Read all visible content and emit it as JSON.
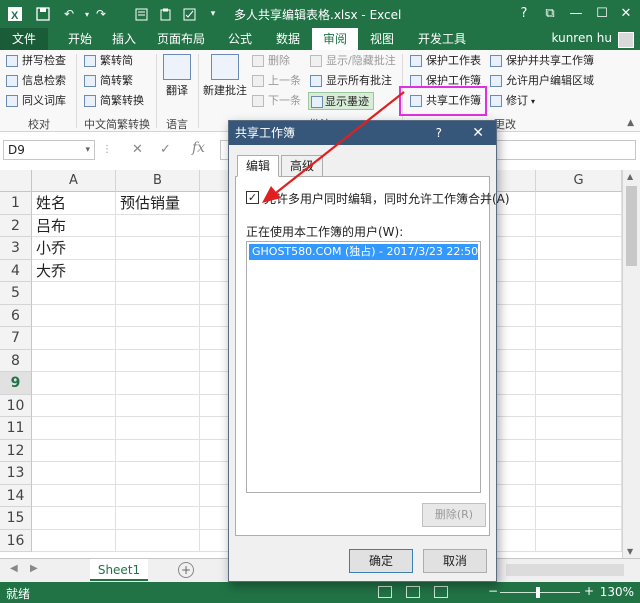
{
  "titlebar": {
    "title": "多人共享编辑表格.xlsx - Excel",
    "help": "?",
    "restore": "⧉",
    "minimize": "—",
    "maximize": "☐",
    "close": "✕"
  },
  "tabs": {
    "file": "文件",
    "items": [
      "开始",
      "插入",
      "页面布局",
      "公式",
      "数据",
      "审阅",
      "视图",
      "开发工具"
    ],
    "active": "审阅",
    "user": "kunren hu"
  },
  "ribbon": {
    "proofing": {
      "spell": "拼写检查",
      "research": "信息检索",
      "thesaurus": "同义词库",
      "label": "校对"
    },
    "chinese": {
      "t2s": "繁转简",
      "s2t": "简转繁",
      "convert": "简繁转换",
      "label": "中文简繁转换"
    },
    "language": {
      "translate": "翻译",
      "label": "语言"
    },
    "comments": {
      "new": "新建批注",
      "delete": "删除",
      "prev": "上一条",
      "next": "下一条",
      "showhide": "显示/隐藏批注",
      "showall": "显示所有批注",
      "ink": "显示墨迹",
      "label": "批注"
    },
    "changes": {
      "protect_sheet": "保护工作表",
      "protect_book": "保护工作簿",
      "share_book": "共享工作簿",
      "protect_share": "保护并共享工作簿",
      "allow_edit": "允许用户编辑区域",
      "track": "修订",
      "label": "更改"
    }
  },
  "formula_bar": {
    "namebox": "D9",
    "fx": "fx",
    "cancel": "✕",
    "enter": "✓"
  },
  "grid": {
    "columns": [
      "A",
      "B",
      "C",
      "D",
      "E",
      "F",
      "G"
    ],
    "rows": [
      "1",
      "2",
      "3",
      "4",
      "5",
      "6",
      "7",
      "8",
      "9",
      "10",
      "11",
      "12",
      "13",
      "14",
      "15",
      "16"
    ],
    "selected_row": "9",
    "cells": {
      "A1": "姓名",
      "B1": "预估销量",
      "A2": "吕布",
      "A3": "小乔",
      "A4": "大乔"
    }
  },
  "sheets": {
    "active": "Sheet1",
    "add": "+"
  },
  "statusbar": {
    "ready": "就绪",
    "zoom": "130%"
  },
  "dialog": {
    "title": "共享工作簿",
    "help": "?",
    "close": "✕",
    "tab_edit": "编辑",
    "tab_advanced": "高级",
    "allow_multi": "允许多用户同时编辑，同时允许工作簿合并(A)",
    "allow_multi_checked": true,
    "users_label": "正在使用本工作簿的用户(W):",
    "users": [
      "GHOST580.COM (独占) - 2017/3/23 22:50"
    ],
    "remove": "删除(R)",
    "ok": "确定",
    "cancel": "取消"
  },
  "colors": {
    "accent": "#217346",
    "highlight_box": "#e030e0",
    "arrow": "#e02020",
    "selection": "#3399ff"
  }
}
